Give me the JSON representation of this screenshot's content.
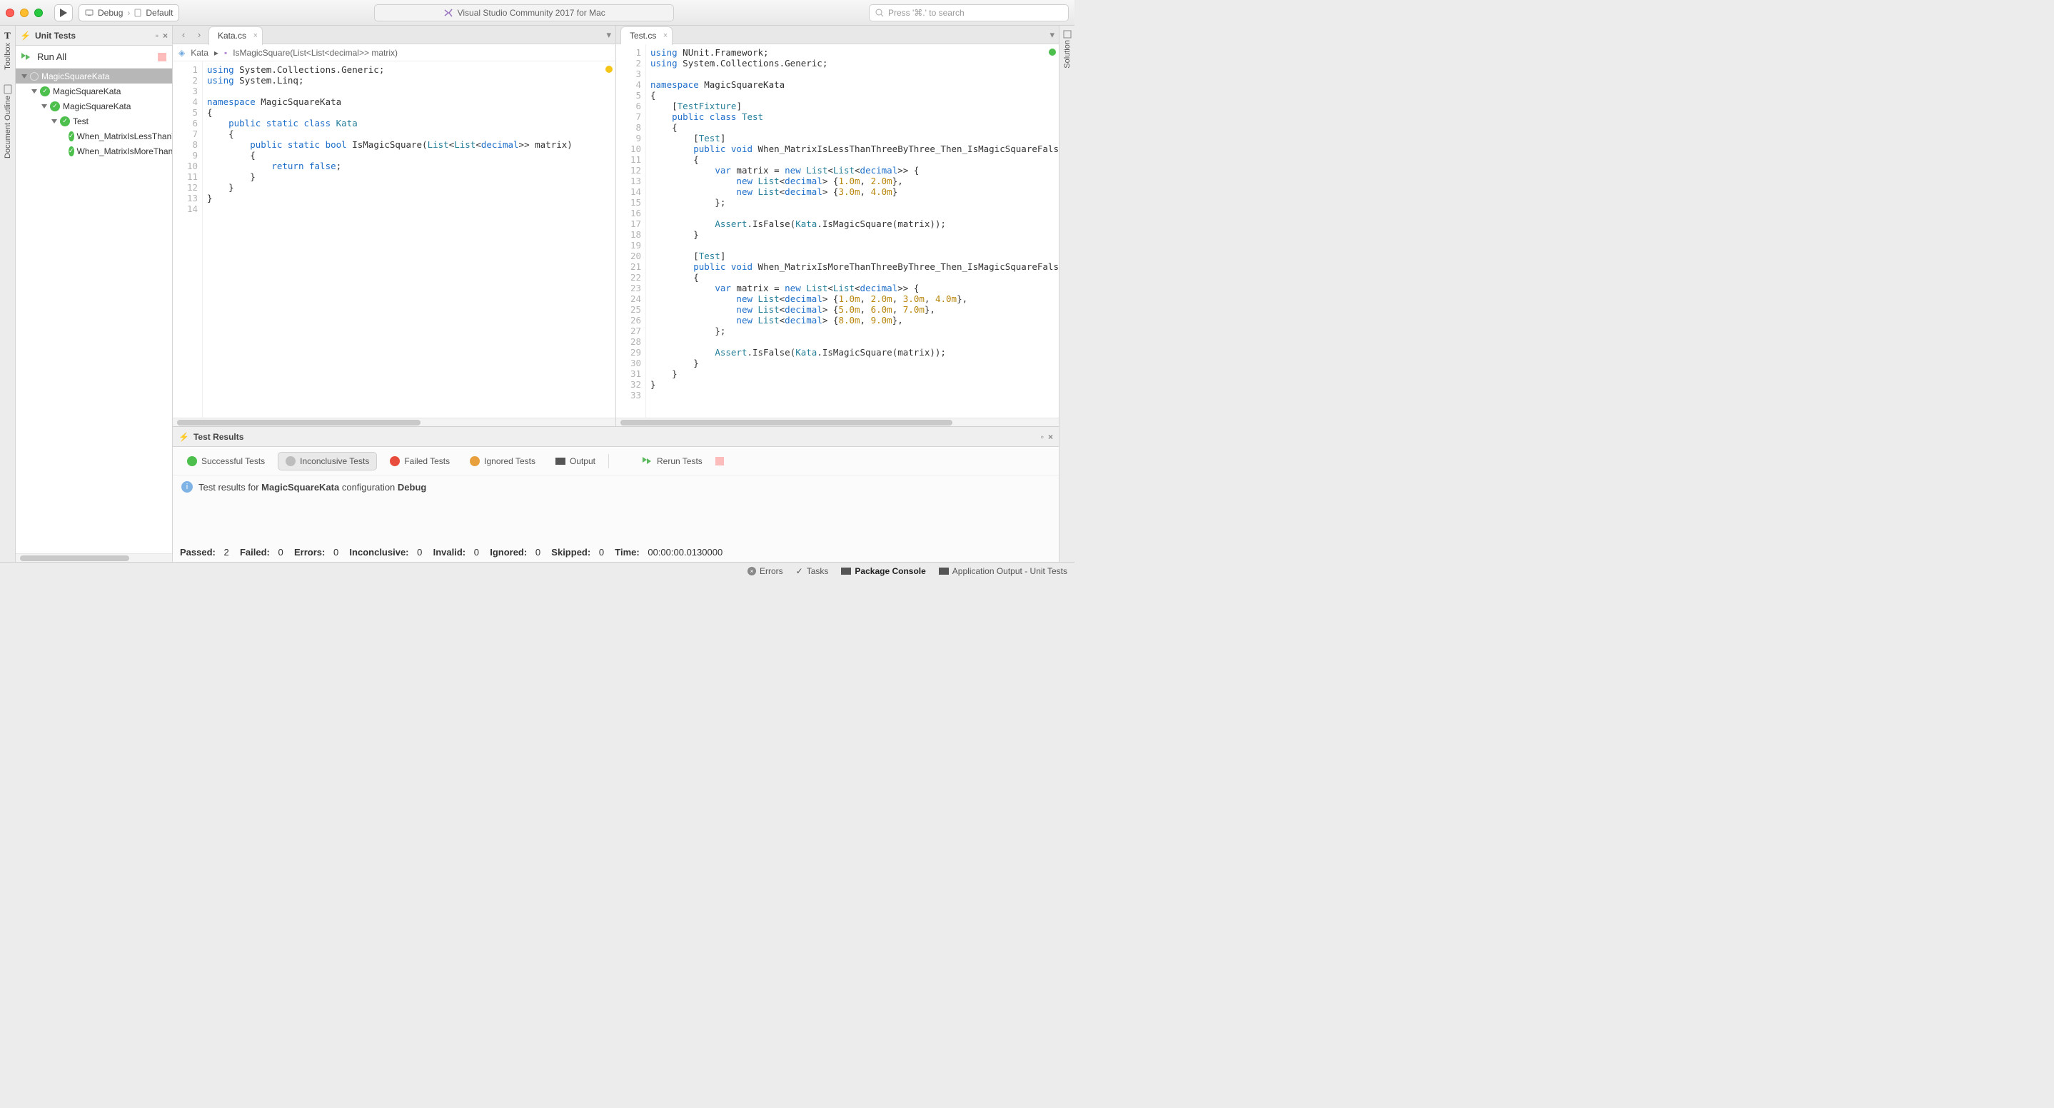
{
  "titlebar": {
    "config": "Debug",
    "target": "Default",
    "app_title": "Visual Studio Community 2017 for Mac",
    "search_placeholder": "Press '⌘.' to search"
  },
  "left_rail": {
    "toolbox": "Toolbox",
    "outline": "Document Outline"
  },
  "right_rail": {
    "solution": "Solution"
  },
  "unit_tests": {
    "title": "Unit Tests",
    "run_all": "Run All",
    "tree": {
      "root": "MagicSquareKata",
      "proj": "MagicSquareKata",
      "ns": "MagicSquareKata",
      "cls": "Test",
      "t1": "When_MatrixIsLessThanThreeByThree_Then_IsMagicSquareFalse",
      "t2": "When_MatrixIsMoreThanThreeByThree_Then_IsMagicSquareFalse"
    }
  },
  "tabs": {
    "left": "Kata.cs",
    "right": "Test.cs"
  },
  "breadcrumb": {
    "cls": "Kata",
    "method": "IsMagicSquare(List<List<decimal>> matrix)"
  },
  "kata_lines": 14,
  "test_lines": 33,
  "results": {
    "title": "Test Results",
    "filters": {
      "successful": "Successful Tests",
      "inconclusive": "Inconclusive Tests",
      "failed": "Failed Tests",
      "ignored": "Ignored Tests",
      "output": "Output",
      "rerun": "Rerun Tests"
    },
    "info_prefix": "Test results for ",
    "info_project": "MagicSquareKata",
    "info_mid": " configuration ",
    "info_config": "Debug",
    "stats": {
      "passed_l": "Passed:",
      "passed": "2",
      "failed_l": "Failed:",
      "failed": "0",
      "errors_l": "Errors:",
      "errors": "0",
      "inconclusive_l": "Inconclusive:",
      "inconclusive": "0",
      "invalid_l": "Invalid:",
      "invalid": "0",
      "ignored_l": "Ignored:",
      "ignored": "0",
      "skipped_l": "Skipped:",
      "skipped": "0",
      "time_l": "Time:",
      "time": "00:00:00.0130000"
    }
  },
  "statusbar": {
    "errors": "Errors",
    "tasks": "Tasks",
    "pkg": "Package Console",
    "appout": "Application Output - Unit Tests"
  }
}
